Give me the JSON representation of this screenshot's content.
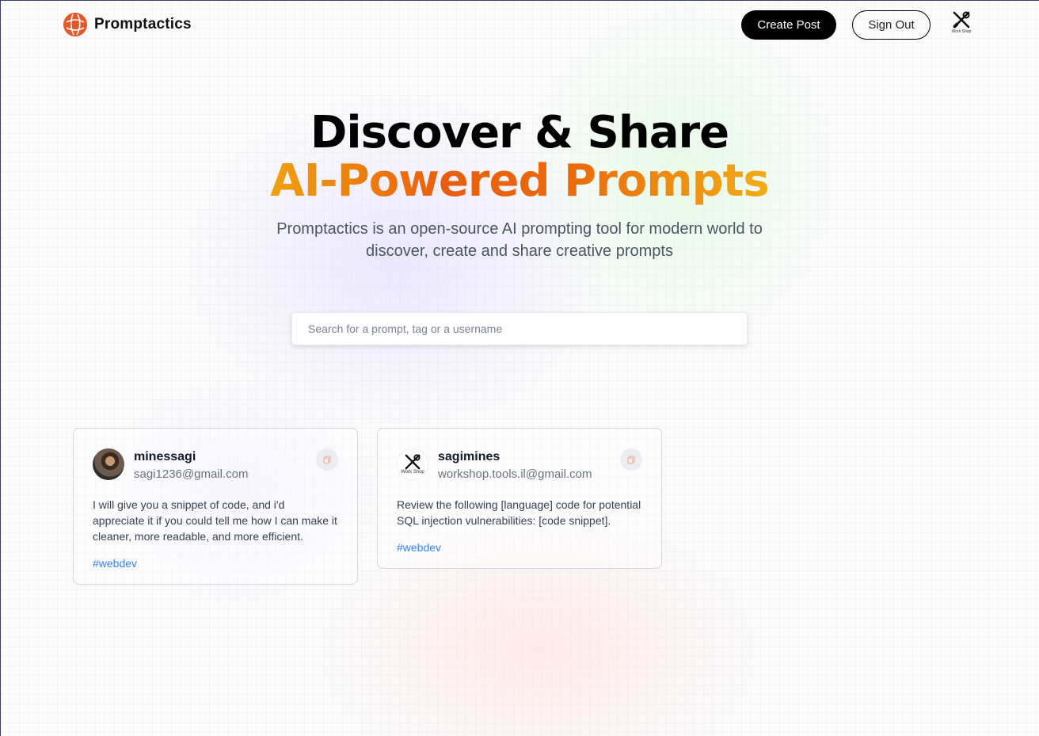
{
  "nav": {
    "brand": "Promptactics",
    "create_label": "Create Post",
    "signout_label": "Sign Out",
    "profile_caption": "Work Shop",
    "icons": {
      "logo": "globe-logo-icon",
      "profile": "tools-workshop-icon"
    },
    "accent_color": "#e8572a"
  },
  "hero": {
    "title_line1": "Discover & Share",
    "title_line2": "AI-Powered Prompts",
    "description": "Promptactics is an open-source AI prompting tool for modern world to discover, create and share creative prompts"
  },
  "search": {
    "placeholder": "Search for a prompt, tag or a username",
    "value": ""
  },
  "posts": [
    {
      "username": "minessagi",
      "email": "sagi1236@gmail.com",
      "prompt": "I will give you a snippet of code, and i'd appreciate it if you could tell me how I can make it cleaner, more readable, and more efficient.",
      "tag": "#webdev"
    },
    {
      "username": "sagimines",
      "email": "workshop.tools.il@gmail.com",
      "avatar_caption": "Work Shop",
      "prompt": "Review the following [language] code for potential SQL injection vulnerabilities: [code snippet].",
      "tag": "#webdev"
    }
  ]
}
